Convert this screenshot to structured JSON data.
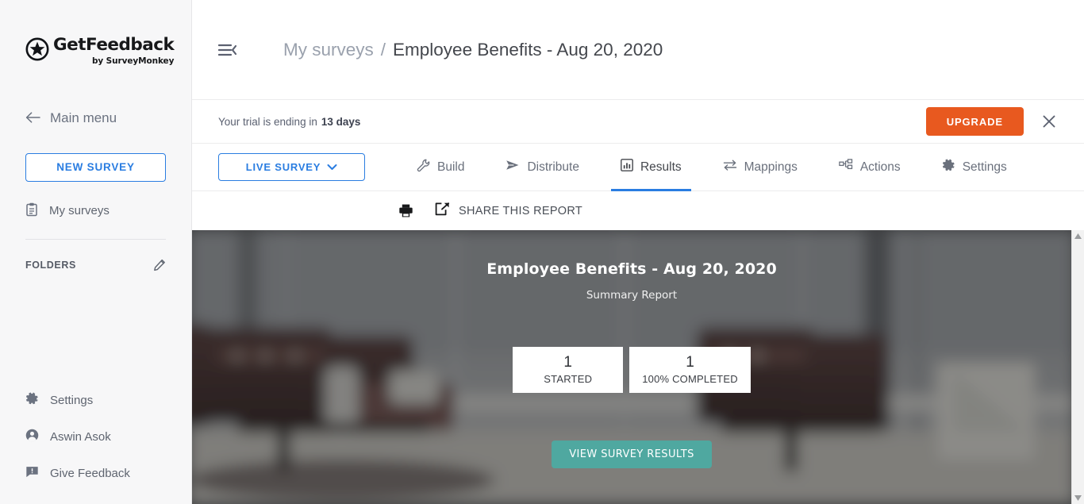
{
  "sidebar": {
    "logo": {
      "name": "GetFeedback",
      "sub": "by SurveyMonkey",
      "icon": "star-badge-icon"
    },
    "main_menu": {
      "label": "Main menu",
      "icon": "arrow-left-icon"
    },
    "new_survey": {
      "label": "NEW SURVEY"
    },
    "my_surveys": {
      "label": "My surveys",
      "icon": "clipboard-icon"
    },
    "folders": {
      "label": "FOLDERS",
      "edit_icon": "pencil-icon"
    },
    "bottom_items": [
      {
        "label": "Settings",
        "icon": "gear-icon"
      },
      {
        "label": "Aswin Asok",
        "icon": "user-circle-icon"
      },
      {
        "label": "Give Feedback",
        "icon": "feedback-icon"
      }
    ]
  },
  "header": {
    "collapse_icon": "collapse-sidebar-icon",
    "breadcrumb": {
      "parent": "My surveys",
      "separator": "/",
      "current": "Employee Benefits - Aug 20, 2020"
    }
  },
  "trial_banner": {
    "text": "Your trial is ending in",
    "days": "13 days",
    "upgrade_label": "UPGRADE",
    "close_icon": "close-icon"
  },
  "tabbar": {
    "live_survey": {
      "label": "LIVE SURVEY",
      "icon": "chevron-down-icon"
    },
    "tabs": [
      {
        "label": "Build",
        "icon": "wrench-icon",
        "active": false
      },
      {
        "label": "Distribute",
        "icon": "send-icon",
        "active": false
      },
      {
        "label": "Results",
        "icon": "bar-chart-icon",
        "active": true
      },
      {
        "label": "Mappings",
        "icon": "transfer-arrows-icon",
        "active": false
      },
      {
        "label": "Actions",
        "icon": "sitemap-icon",
        "active": false
      },
      {
        "label": "Settings",
        "icon": "gear-icon",
        "active": false
      }
    ]
  },
  "report_toolbar": {
    "print_icon": "printer-icon",
    "share_icon": "share-external-icon",
    "share_label": "SHARE THIS REPORT"
  },
  "hero": {
    "title": "Employee Benefits - Aug 20, 2020",
    "subtitle": "Summary Report",
    "stats": [
      {
        "value": "1",
        "label": "STARTED"
      },
      {
        "value": "1",
        "label": "100% COMPLETED"
      }
    ],
    "cta_label": "VIEW SURVEY RESULTS"
  },
  "scrollbar": {
    "up_icon": "scroll-up-arrow-icon",
    "down_icon": "scroll-down-arrow-icon"
  },
  "colors": {
    "brand_blue": "#2a7de1",
    "upgrade_orange": "#e8591f",
    "cta_teal": "#4fa8a0",
    "sidebar_bg": "#f7f7f8",
    "hero_bg": "#4e5052"
  }
}
